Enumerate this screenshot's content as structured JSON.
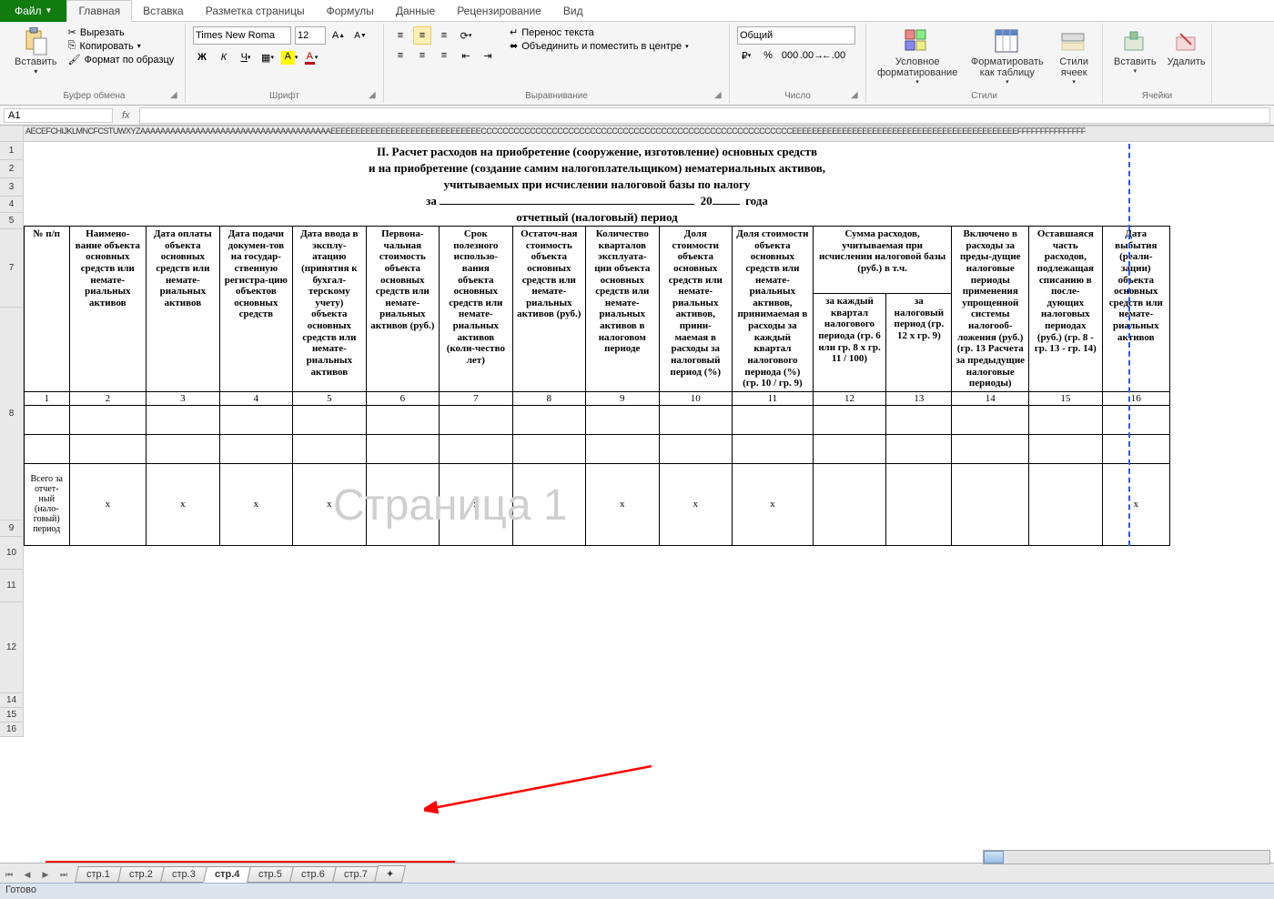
{
  "tabs": {
    "file": "Файл",
    "home": "Главная",
    "insert": "Вставка",
    "pagelayout": "Разметка страницы",
    "formulas": "Формулы",
    "data": "Данные",
    "review": "Рецензирование",
    "view": "Вид"
  },
  "clipboard": {
    "paste": "Вставить",
    "cut": "Вырезать",
    "copy": "Копировать",
    "formatp": "Формат по образцу",
    "group": "Буфер обмена"
  },
  "font": {
    "name": "Times New Roma",
    "size": "12",
    "group": "Шрифт"
  },
  "alignment": {
    "wrap": "Перенос текста",
    "merge": "Объединить и поместить в центре",
    "group": "Выравнивание"
  },
  "number": {
    "format": "Общий",
    "group": "Число"
  },
  "styles": {
    "cond": "Условное форматирование",
    "fmttable": "Форматировать как таблицу",
    "cellstyles": "Стили ячеек",
    "group": "Стили"
  },
  "cells": {
    "insert": "Вставить",
    "delete": "Удалить",
    "group": "Ячейки"
  },
  "namebox": "A1",
  "colstrip": "AECEFCHIJKLMNCFCSTUWXYZAAAAAAAAAAAAAAAAAAAAAAAAAAAAAAAAAAAAAAEEEEEEEEEEEEEEEEEEEEEEEEEEEEEECCCCCCCCCCCCCCCCCCCCCCCCCCCCCCCCCCCCCCCCCCCCCCCCCCCCCCCCCEEEEEEEEEEEEEEEEEEEEEEEEEEEEEEEEEEEEEEEEEEEEEFFFFFFFFFFFFFFF",
  "rows": [
    "1",
    "2",
    "3",
    "4",
    "5",
    "7",
    "8",
    "9",
    "10",
    "11",
    "12",
    "14",
    "15",
    "16"
  ],
  "title1": "II. Расчет расходов на приобретение (сооружение, изготовление) основных средств",
  "title2": "и на приобретение (создание самим налогоплательщиком) нематериальных активов,",
  "title3": "учитываемых при исчислении налоговой базы по налогу",
  "period_za": "за",
  "period_20": "20",
  "period_goda": "года",
  "period_label": "отчетный (налоговый) период",
  "headers": [
    "№ п/п",
    "Наимено-вание объекта основных средств или немате-риальных активов",
    "Дата оплаты объекта основных средств или немате-риальных активов",
    "Дата подачи докумен-тов на государ-ственную регистра-цию объектов основных средств",
    "Дата ввода в эксплу-атацию (принятия к бухгал-терскому учету) объекта основных средств или немате-риальных активов",
    "Первона-чальная стоимость объекта основных средств или немате-риальных активов (руб.)",
    "Срок полезного использо-вания объекта основных средств или немате-риальных активов (коли-чество лет)",
    "Остаточ-ная стоимость объекта основных средств или немате-риальных активов (руб.)",
    "Количество кварталов эксплуата-ции объекта основных средств или немате-риальных активов в налоговом периоде",
    "Доля стоимости объекта основных средств или немате-риальных активов, прини-маемая в расходы за налоговый период (%)",
    "Доля стоимости объекта основных средств или немате-риальных активов, принимаемая в расходы за каждый квартал налогового периода (%) (гр. 10 / гр. 9)",
    "Сумма расходов, учитываемая при исчислении налоговой базы (руб.) в т.ч.",
    "за каждый квартал налогового периода (гр. 6 или гр. 8 x гр. 11 / 100)",
    "за налоговый период (гр. 12 x гр. 9)",
    "Включено в расходы за преды-дущие налоговые периоды применения упрощенной системы налогооб-ложения (руб.) (гр. 13 Расчета за предыдущие налоговые периоды)",
    "Оставшаяся часть расходов, подлежащая списанию в после-дующих налоговых периодах (руб.) (гр. 8 - гр. 13 - гр. 14)",
    "Дата выбытия (реали-зации) объекта основных средств или немате-риальных активов"
  ],
  "nums": [
    "1",
    "2",
    "3",
    "4",
    "5",
    "6",
    "7",
    "8",
    "9",
    "10",
    "11",
    "12",
    "13",
    "14",
    "15",
    "16"
  ],
  "total_label": "Всего за отчет-ный (нало-говый) период",
  "x": "x",
  "watermark": "Страница 1",
  "sheets": [
    "стр.1",
    "стр.2",
    "стр.3",
    "стр.4",
    "стр.5",
    "стр.6",
    "стр.7"
  ],
  "active_sheet": 3,
  "status": "Готово"
}
